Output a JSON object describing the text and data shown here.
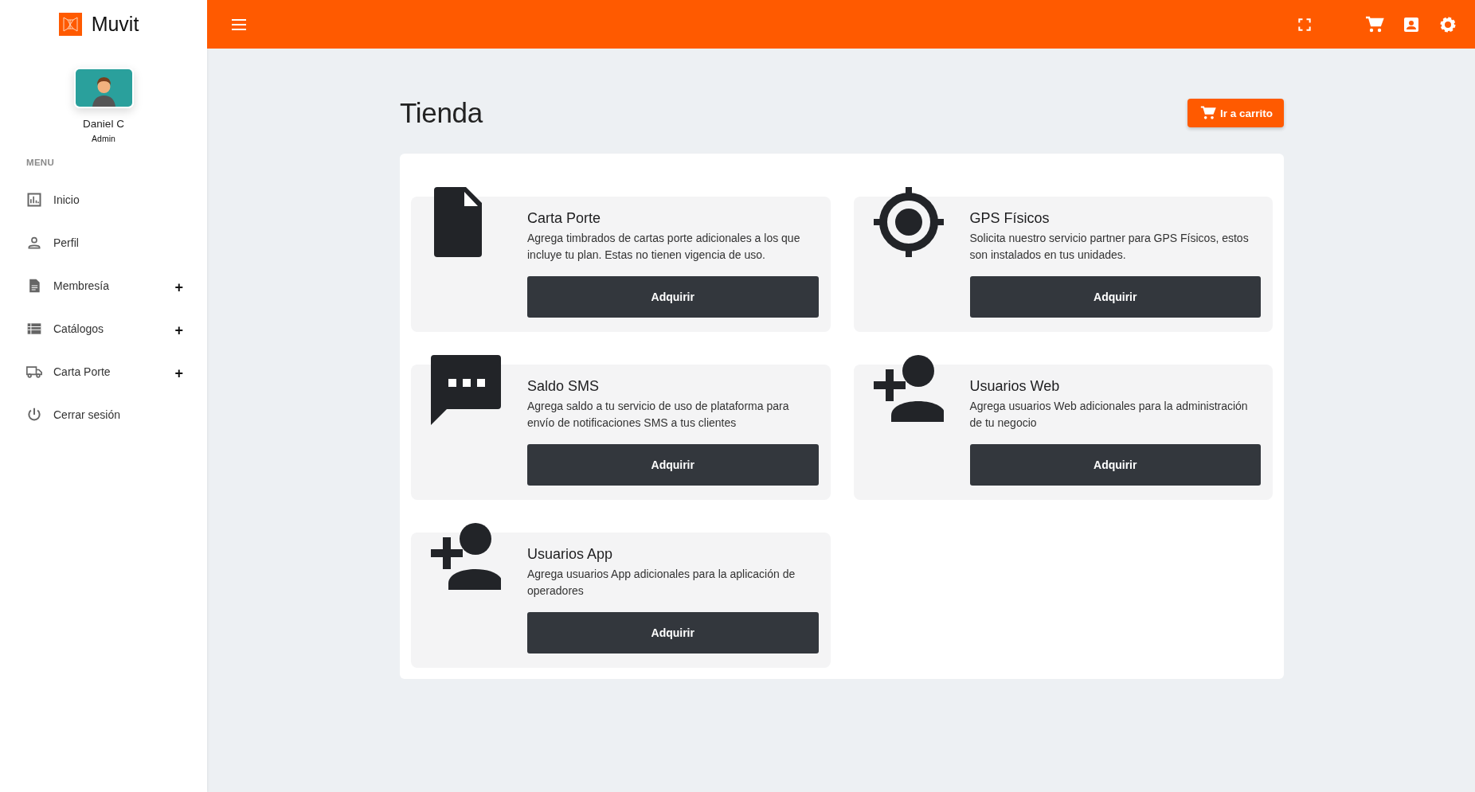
{
  "app": {
    "name": "Muvit"
  },
  "user": {
    "name": "Daniel C",
    "role": "Admin"
  },
  "menu": {
    "heading": "MENU",
    "items": [
      {
        "label": "Inicio"
      },
      {
        "label": "Perfil"
      },
      {
        "label": "Membresía",
        "expander": "+"
      },
      {
        "label": "Catálogos",
        "expander": "+"
      },
      {
        "label": "Carta Porte",
        "expander": "+"
      },
      {
        "label": "Cerrar sesión"
      }
    ]
  },
  "page": {
    "title": "Tienda",
    "cart_button": "Ir a carrito"
  },
  "products": [
    {
      "title": "Carta Porte",
      "description": "Agrega timbrados de cartas porte adicionales a los que incluye tu plan. Estas no tienen vigencia de uso.",
      "button": "Adquirir"
    },
    {
      "title": "GPS Físicos",
      "description": "Solicita nuestro servicio partner para GPS Físicos, estos son instalados en tus unidades.",
      "button": "Adquirir"
    },
    {
      "title": "Saldo SMS",
      "description": "Agrega saldo a tu servicio de uso de plataforma para envío de notificaciones SMS a tus clientes",
      "button": "Adquirir"
    },
    {
      "title": "Usuarios Web",
      "description": "Agrega usuarios Web adicionales para la administración de tu negocio",
      "button": "Adquirir"
    },
    {
      "title": "Usuarios App",
      "description": "Agrega usuarios App adicionales para la aplicación de operadores",
      "button": "Adquirir"
    }
  ]
}
